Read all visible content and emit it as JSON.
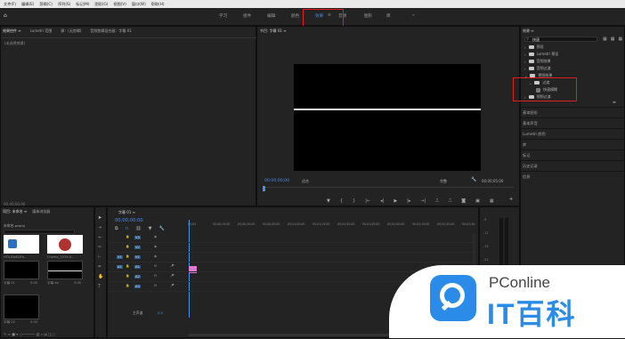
{
  "menu": [
    "文件(F)",
    "编辑(E)",
    "剪辑(C)",
    "序列(S)",
    "标记(M)",
    "图形(G)",
    "视图(V)",
    "窗口(W)",
    "帮助(H)"
  ],
  "workspaces": [
    {
      "label": "学习",
      "active": false
    },
    {
      "label": "组件",
      "active": false
    },
    {
      "label": "编辑",
      "active": false
    },
    {
      "label": "颜色",
      "active": false
    },
    {
      "label": "效果",
      "active": true
    },
    {
      "label": "≡",
      "active": false
    },
    {
      "label": "音频",
      "active": false
    },
    {
      "label": "图形",
      "active": false
    },
    {
      "label": "库",
      "active": false
    },
    {
      "label": "»",
      "active": false
    }
  ],
  "source_panel": {
    "tabs": [
      "效果控件 ≡",
      "Lumetri 范围",
      "源：(无剪辑)",
      "音频剪辑混合器：字幕 01"
    ],
    "empty_text": "(未选择剪辑)",
    "timecode": "00;00;00;00"
  },
  "program_panel": {
    "title": "节目: 字幕 01 ≡",
    "timecode_left": "00;00;00;00",
    "fit_label": "适合",
    "quality_label": "完整",
    "timecode_right": "00;00;05;00"
  },
  "project_panel": {
    "tabs": [
      "项目: 未命名 ≡",
      "媒体浏览器"
    ],
    "file_name": "未命名.prproj",
    "items": [
      {
        "name": "HTA18aEDFb...",
        "meta": ""
      },
      {
        "name": "f-home_2019-0...",
        "meta": ""
      },
      {
        "name": "字幕 01",
        "meta": "5:00"
      },
      {
        "name": "字幕 4e",
        "meta": "5:00"
      },
      {
        "name": "字幕 02",
        "meta": "5:00"
      },
      {
        "name": "字幕 03",
        "meta": "5:00"
      },
      {
        "name": "字幕 07",
        "meta": ""
      }
    ]
  },
  "timeline": {
    "tab": "字幕 01 ≡",
    "timecode": "00;00;00;00",
    "ruler": [
      "00;00",
      "00;00;15;00",
      "00;00;30;00",
      "00;00;45;00",
      "00;01;00;00",
      "00;01;15;00",
      "00;01;30;00",
      "00;01;45;00",
      "00;02;00;00",
      "00;02;15;00",
      "00;02;30;00",
      "00;02;45;"
    ],
    "video_tracks": [
      "V3",
      "V2",
      "V1"
    ],
    "audio_tracks": [
      "A1",
      "A2",
      "A3"
    ],
    "master_label": "主声道",
    "master_value": "0.0",
    "source_v": "V1",
    "source_a": "A1"
  },
  "effects_panel": {
    "title": "效果 ≡",
    "search_value": "快速",
    "tree": [
      {
        "label": "预设",
        "indent": 0
      },
      {
        "label": "Lumetri 预设",
        "indent": 0
      },
      {
        "label": "音频效果",
        "indent": 0
      },
      {
        "label": "音频过渡",
        "indent": 0
      },
      {
        "label": "视频效果",
        "indent": 0
      },
      {
        "label": "过渡",
        "indent": 1
      },
      {
        "label": "快速模糊",
        "indent": 2
      },
      {
        "label": "视频过渡",
        "indent": 0
      }
    ],
    "sections": [
      "基本图形",
      "基本声音",
      "Lumetri 颜色",
      "库",
      "标记",
      "历史记录",
      "信息"
    ]
  },
  "watermark": {
    "brand_en": "PConline",
    "brand_cn": "IT百科"
  },
  "colors": {
    "accent": "#4d8fe8",
    "highlight_box": "#e01e1e",
    "clip_pink": "#d97bd6"
  }
}
